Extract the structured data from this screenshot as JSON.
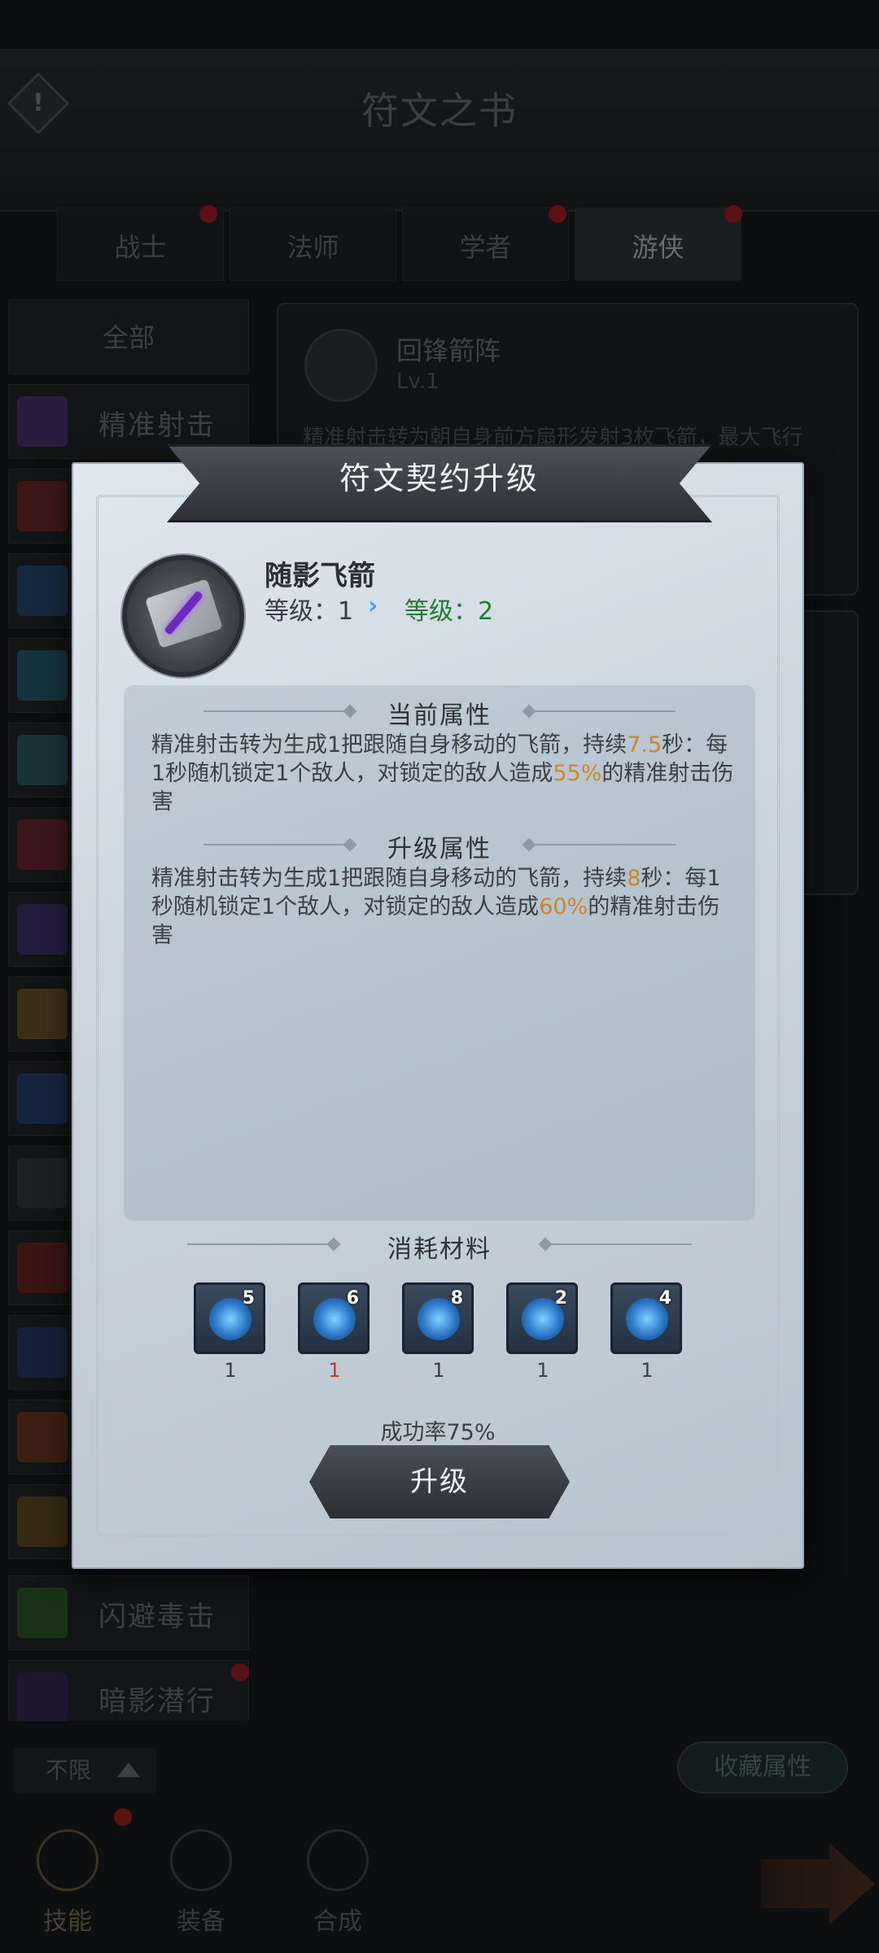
{
  "background": {
    "title": "符文之书",
    "alert_glyph": "!",
    "tabs": [
      {
        "label": "战士",
        "active": false
      },
      {
        "label": "法师",
        "active": false
      },
      {
        "label": "学者",
        "active": false
      },
      {
        "label": "游侠",
        "active": true
      }
    ],
    "sidebar": {
      "all_label": "全部",
      "items": [
        {
          "label": "精准射击",
          "icon": "precision-shot-icon"
        },
        {
          "label": "",
          "icon": "rune-icon"
        },
        {
          "label": "",
          "icon": "rune-icon"
        },
        {
          "label": "",
          "icon": "rune-icon"
        },
        {
          "label": "",
          "icon": "rune-icon"
        },
        {
          "label": "",
          "icon": "rune-icon"
        },
        {
          "label": "",
          "icon": "rune-icon"
        },
        {
          "label": "",
          "icon": "rune-icon"
        },
        {
          "label": "",
          "icon": "rune-icon"
        },
        {
          "label": "",
          "icon": "rune-icon"
        },
        {
          "label": "",
          "icon": "rune-icon"
        },
        {
          "label": "",
          "icon": "rune-icon"
        },
        {
          "label": "",
          "icon": "rune-icon"
        },
        {
          "label": "",
          "icon": "rune-icon"
        },
        {
          "label": "闪避毒击",
          "icon": "dodge-poison-icon"
        },
        {
          "label": "暗影潜行",
          "icon": "shadow-stealth-icon"
        }
      ]
    },
    "detail": {
      "name": "回锋箭阵",
      "level": "Lv.1",
      "desc": "精准射击转为朝自身前方扇形发射3枚飞箭，最大飞行"
    },
    "filter_label": "不限",
    "fav_label": "收藏属性",
    "nav": [
      {
        "label": "技能",
        "active": true
      },
      {
        "label": "装备",
        "active": false
      },
      {
        "label": "合成",
        "active": false
      }
    ]
  },
  "dialog": {
    "title": "符文契约升级",
    "skill_name": "随影飞箭",
    "level_current": "等级：1",
    "level_next": "等级：2",
    "level_arrow": "›",
    "current_header": "当前属性",
    "current_desc": {
      "a": "精准射击转为生成1把跟随自身移动的飞箭，持续",
      "v1": "7.5",
      "b": "秒：每1秒随机锁定1个敌人，对锁定的敌人造成",
      "v2": "55%",
      "c": "的精准射击伤害"
    },
    "upgrade_header": "升级属性",
    "upgrade_desc": {
      "a": "精准射击转为生成1把跟随自身移动的飞箭，持续",
      "v1": "8",
      "b": "秒：每1秒随机锁定1个敌人，对锁定的敌人造成",
      "v2": "60%",
      "c": "的精准射击伤害"
    },
    "materials_header": "消耗材料",
    "materials": [
      {
        "owned": "5",
        "cost": "1",
        "enough": true
      },
      {
        "owned": "6",
        "cost": "1",
        "enough": false
      },
      {
        "owned": "8",
        "cost": "1",
        "enough": true
      },
      {
        "owned": "2",
        "cost": "1",
        "enough": true
      },
      {
        "owned": "4",
        "cost": "1",
        "enough": true
      }
    ],
    "success_rate": "成功率75%",
    "upgrade_button": "升级"
  },
  "colors": {
    "highlight": "#c9872a",
    "next_level": "#237a2e",
    "insufficient": "#c0392b"
  }
}
